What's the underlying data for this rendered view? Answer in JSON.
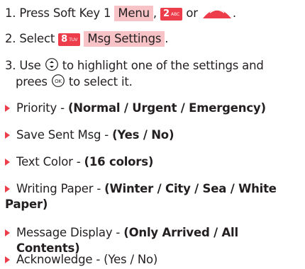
{
  "steps": {
    "s1_prefix": "1. Press Soft Key 1",
    "s1_menu": "Menu",
    "s1_comma": ",",
    "s1_key": "2",
    "s1_key_sub": "ABC",
    "s1_or": "or",
    "s1_end": ".",
    "s2_prefix": "2. Select",
    "s2_key": "8",
    "s2_key_sub": "TUV",
    "s2_label": "Msg Settings",
    "s2_end": ".",
    "s3_a": "3. Use",
    "s3_b": "to highlight one of the settings and",
    "s3_c": "prees",
    "s3_d": "to select it."
  },
  "options": [
    {
      "name": "Priority - ",
      "values": "(Normal / Urgent / Emergency)"
    },
    {
      "name": "Save Sent Msg - ",
      "values": "(Yes / No)"
    },
    {
      "name": "Text Color - ",
      "values": "(16 colors)"
    },
    {
      "name": "Writing Paper - ",
      "values": "(Winter / City / Sea / White",
      "values2": "Paper)"
    },
    {
      "name": "Message Display - ",
      "values": "(Only Arrived / All Contents)"
    },
    {
      "name": "Acknowledge - (Yes / No)"
    }
  ],
  "icons": {
    "nav": "navigation-key-icon",
    "ok": "ok-key-icon",
    "menu": "menu-button-icon"
  },
  "colors": {
    "accent": "#ee3d4a",
    "highlight": "#f7c3c6",
    "text": "#231f20"
  }
}
